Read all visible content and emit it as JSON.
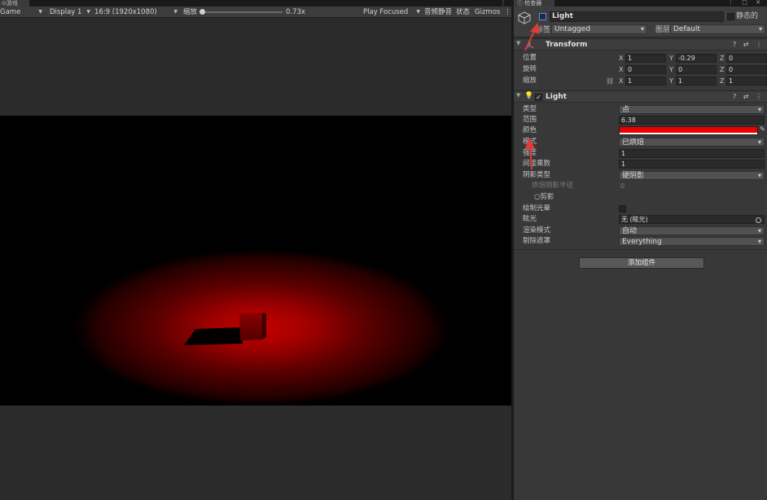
{
  "game": {
    "tab_label": "游戏",
    "tab_menu": "⋮",
    "toolbar": {
      "mode": "Game",
      "display": "Display 1",
      "aspect": "16:9 (1920x1080)",
      "scale_label": "缩放",
      "scale_value": "0.73x",
      "play_mode": "Play Focused",
      "mute_audio": "音频静音",
      "stats": "状态",
      "gizmos": "Gizmos",
      "more": "⋮"
    }
  },
  "inspector": {
    "tab_label": "检查器",
    "tab_controls": "⋮ □ ✕",
    "object": {
      "name": "Light",
      "static_label": "静态的",
      "tag_label": "标签",
      "tag_value": "Untagged",
      "layer_label": "图层",
      "layer_value": "Default",
      "active": true
    },
    "transform": {
      "title": "Transform",
      "buttons": "? ⇄ ⋮",
      "rows": [
        {
          "label": "位置",
          "x": "1",
          "y": "-0.29",
          "z": "0"
        },
        {
          "label": "旋转",
          "x": "0",
          "y": "0",
          "z": "0"
        },
        {
          "label": "缩放",
          "x": "1",
          "y": "1",
          "z": "1"
        }
      ],
      "axis_labels": [
        "X",
        "Y",
        "Z"
      ],
      "link_icon": "⛓"
    },
    "light": {
      "title": "Light",
      "buttons": "? ⇄ ⋮",
      "type_label": "类型",
      "type_value": "点",
      "range_label": "范围",
      "range_value": "6.38",
      "color_label": "颜色",
      "color_hex": "#EE0000",
      "mode_label": "模式",
      "mode_value": "已烘焙",
      "intensity_label": "强度",
      "intensity_value": "1",
      "indirect_label": "间接乘数",
      "indirect_value": "1",
      "shadow_label": "阴影类型",
      "shadow_value": "硬阴影",
      "baked_radius_label": "烘焙阴影半径",
      "baked_radius_value": "0",
      "cookie_label": "○剪影",
      "halo_label": "绘制光晕",
      "flare_label": "眩光",
      "flare_value": "无 (眩光)",
      "render_mode_label": "渲染模式",
      "render_mode_value": "自动",
      "culling_label": "剔除遮罩",
      "culling_value": "Everything"
    },
    "add_component": "添加组件"
  }
}
